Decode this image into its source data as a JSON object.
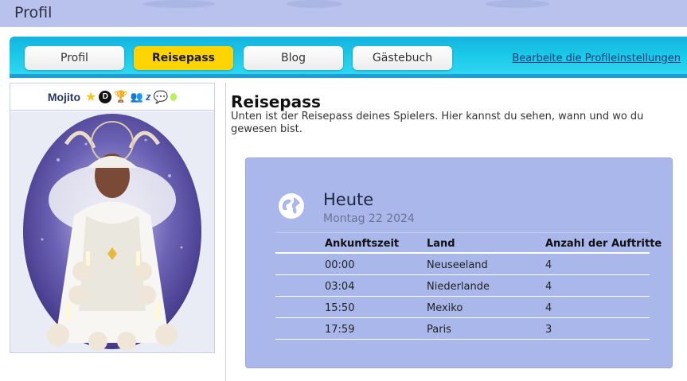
{
  "page": {
    "title": "Profil"
  },
  "nav": {
    "tabs": [
      {
        "label": "Profil",
        "active": false
      },
      {
        "label": "Reisepass",
        "active": true
      },
      {
        "label": "Blog",
        "active": false
      },
      {
        "label": "Gästebuch",
        "active": false
      }
    ],
    "settings_link": "Bearbeite die Profileinstellungen"
  },
  "profile": {
    "username": "Mojito",
    "badges": [
      "star-icon",
      "d-badge-icon",
      "trophy-icon",
      "friends-icon",
      "z-badge-icon",
      "chat-icon",
      "green-dot-icon"
    ]
  },
  "passport": {
    "heading": "Reisepass",
    "intro": "Unten ist der Reisepass deines Spielers. Hier kannst du sehen, wann und wo du gewesen bist.",
    "card": {
      "day": "Heute",
      "date": "Montag 22 2024",
      "columns": [
        "Ankunftszeit",
        "Land",
        "Anzahl der Auftritte"
      ],
      "rows": [
        {
          "time": "00:00",
          "country": "Neuseeland",
          "count": "4"
        },
        {
          "time": "03:04",
          "country": "Niederlande",
          "count": "4"
        },
        {
          "time": "15:50",
          "country": "Mexiko",
          "count": "4"
        },
        {
          "time": "17:59",
          "country": "Paris",
          "count": "3"
        }
      ]
    }
  },
  "colors": {
    "accent": "#ffd400",
    "nav": "#19c7e8",
    "card": "#aab7ea",
    "topbar": "#b8c2ec"
  }
}
